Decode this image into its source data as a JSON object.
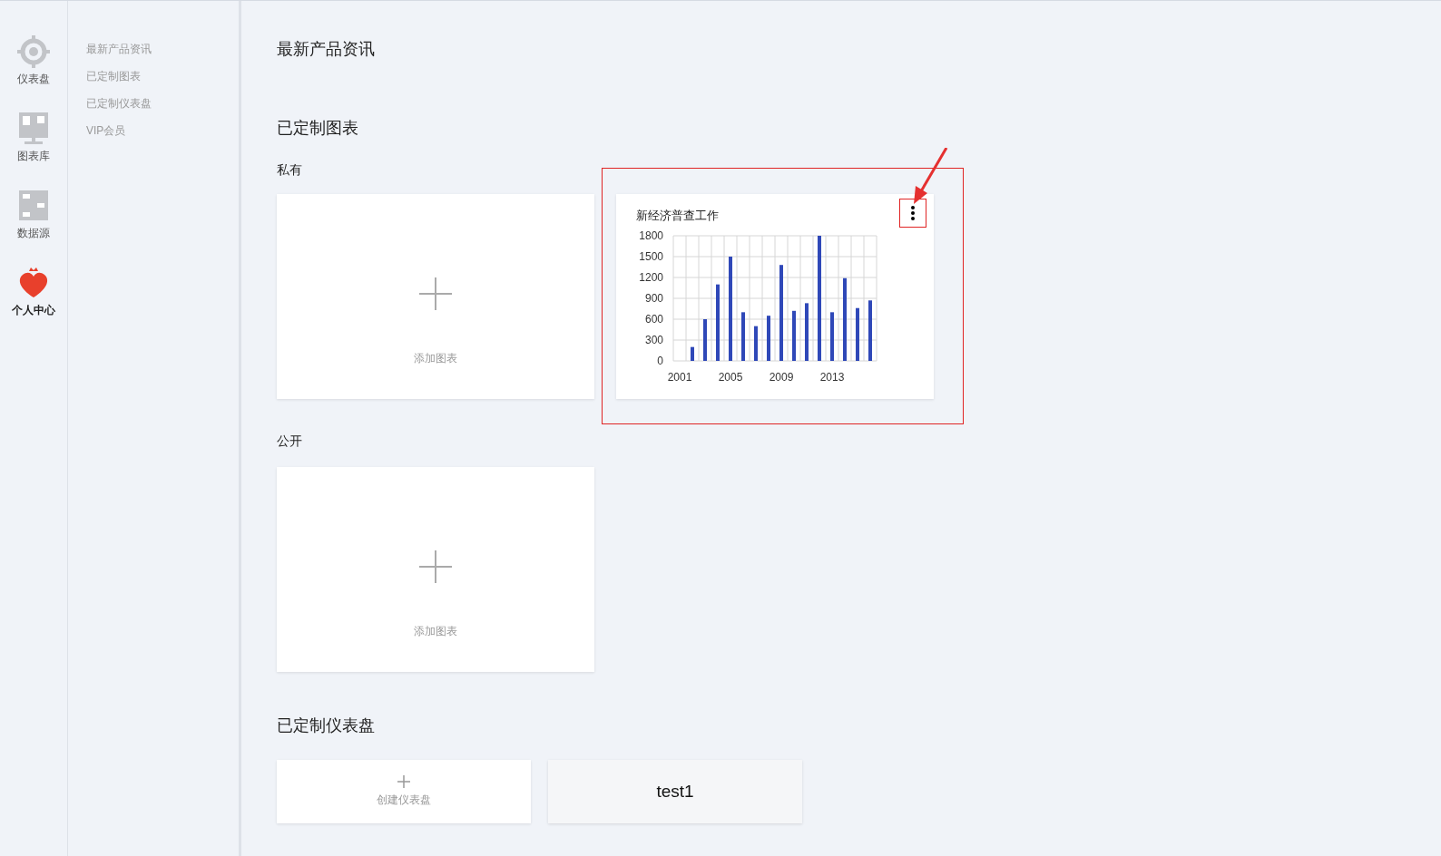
{
  "rail": [
    {
      "label": "仪表盘",
      "kind": "gauge",
      "selected": false
    },
    {
      "label": "图表库",
      "kind": "monitor",
      "selected": false
    },
    {
      "label": "数据源",
      "kind": "blocks",
      "selected": false
    },
    {
      "label": "个人中心",
      "kind": "heart",
      "selected": true
    }
  ],
  "subnav": [
    "最新产品资讯",
    "已定制图表",
    "已定制仪表盘",
    "VIP会员"
  ],
  "main": {
    "news_heading": "最新产品资讯",
    "charts_heading": "已定制图表",
    "private": {
      "label": "私有",
      "add_label": "添加图表",
      "chart_card": {
        "title": "新经济普查工作",
        "highlighted": true,
        "chart_data": {
          "type": "bar",
          "x": [
            2001,
            2002,
            2003,
            2004,
            2005,
            2006,
            2007,
            2008,
            2009,
            2010,
            2011,
            2012,
            2013,
            2014,
            2015,
            2016
          ],
          "series": [
            {
              "color": "#2f48b8",
              "values": [
                0,
                200,
                600,
                1100,
                1500,
                700,
                500,
                650,
                1380,
                720,
                830,
                1800,
                700,
                1190,
                760,
                870
              ]
            }
          ],
          "xlim": [
            2000.5,
            2016.5
          ],
          "grid": true,
          "ylim": [
            0,
            1800
          ],
          "yticks": [
            0,
            300,
            600,
            900,
            1200,
            1500,
            1800
          ],
          "xticks": [
            2001,
            2005,
            2009,
            2013
          ]
        }
      }
    },
    "public": {
      "label": "公开",
      "add_label": "添加图表"
    },
    "dashboards_heading": "已定制仪表盘",
    "create_label": "创建仪表盘",
    "dashboards": [
      "test1"
    ]
  }
}
